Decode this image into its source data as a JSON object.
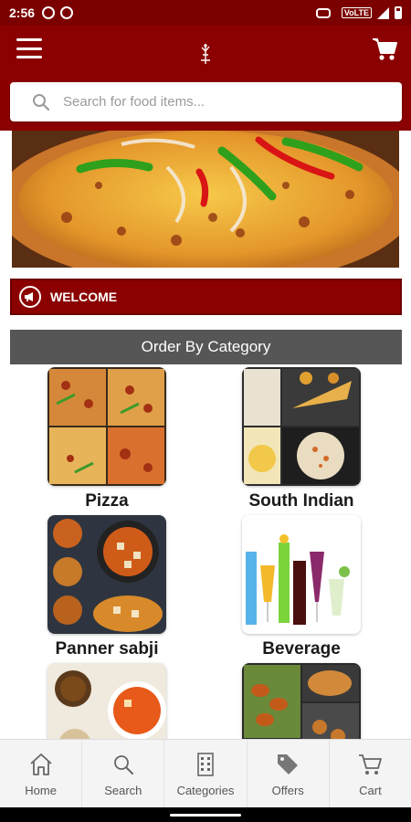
{
  "status_bar": {
    "time": "2:56",
    "network_badge": "VoLTE"
  },
  "header": {
    "search_placeholder": "Search for food items..."
  },
  "welcome": {
    "label": "WELCOME"
  },
  "categories": {
    "title": "Order By Category",
    "items": [
      {
        "label": "Pizza"
      },
      {
        "label": "South Indian"
      },
      {
        "label": "Panner sabji"
      },
      {
        "label": "Beverage"
      },
      {
        "label": ""
      },
      {
        "label": ""
      }
    ]
  },
  "bottom_nav": [
    {
      "label": "Home",
      "icon": "home-icon"
    },
    {
      "label": "Search",
      "icon": "search-icon"
    },
    {
      "label": "Categories",
      "icon": "categories-icon"
    },
    {
      "label": "Offers",
      "icon": "tag-icon"
    },
    {
      "label": "Cart",
      "icon": "cart-icon"
    }
  ],
  "colors": {
    "brand": "#8b0000",
    "status_bar": "#7b0000",
    "category_header": "#565656",
    "nav_bg": "#f4f4f4"
  }
}
